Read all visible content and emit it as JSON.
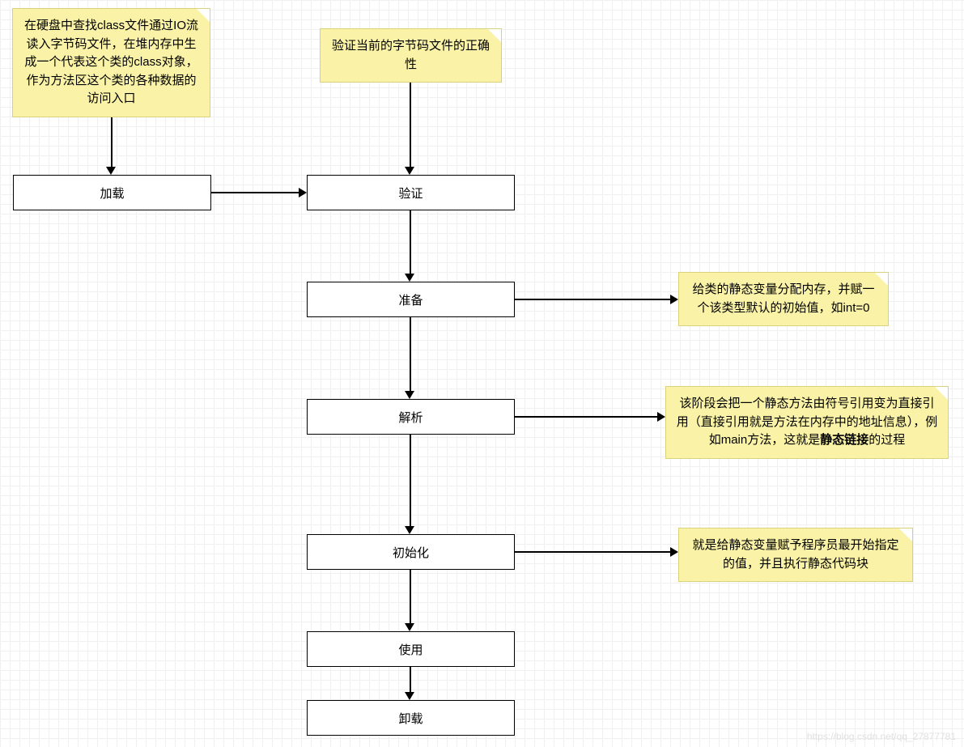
{
  "notes": {
    "load_note": "在硬盘中查找class文件通过IO流读入字节码文件，在堆内存中生成一个代表这个类的class对象，作为方法区这个类的各种数据的访问入口",
    "verify_note": "验证当前的字节码文件的正确性",
    "prepare_note": "给类的静态变量分配内存，并赋一个该类型默认的初始值，如int=0",
    "resolve_note_a": "该阶段会把一个静态方法由符号引用变为直接引用（直接引用就是方法在内存中的地址信息），例如main方法，这就是",
    "resolve_note_b": "静态链接",
    "resolve_note_c": "的过程",
    "init_note": "就是给静态变量赋予程序员最开始指定的值，并且执行静态代码块"
  },
  "boxes": {
    "load": "加载",
    "verify": "验证",
    "prepare": "准备",
    "resolve": "解析",
    "init": "初始化",
    "use": "使用",
    "unload": "卸载"
  },
  "watermark": "https://blog.csdn.net/qq_27877781"
}
